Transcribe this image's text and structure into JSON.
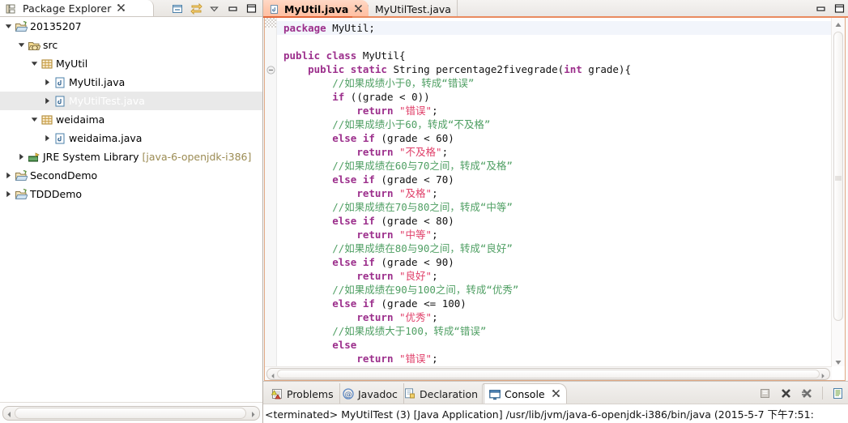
{
  "explorer": {
    "tab_label": "Package Explorer",
    "tab_close_icon": "close-icon",
    "toolbar": [
      {
        "name": "collapse-all-icon",
        "label": "Collapse All"
      },
      {
        "name": "link-with-editor-icon",
        "label": "Link with Editor"
      },
      {
        "name": "view-menu-icon",
        "label": "View Menu"
      },
      {
        "name": "minimize-icon",
        "label": "Minimize"
      },
      {
        "name": "maximize-icon",
        "label": "Maximize"
      }
    ],
    "tree": [
      {
        "label": "20135207",
        "indent": 0,
        "twisty": "expanded",
        "icon": "project-folder-icon",
        "selected": false
      },
      {
        "label": "src",
        "indent": 1,
        "twisty": "expanded",
        "icon": "source-folder-icon",
        "selected": false
      },
      {
        "label": "MyUtil",
        "indent": 2,
        "twisty": "expanded",
        "icon": "package-icon",
        "selected": false
      },
      {
        "label": "MyUtil.java",
        "indent": 3,
        "twisty": "collapsed",
        "icon": "java-file-icon",
        "selected": false
      },
      {
        "label": "MyUtilTest.java",
        "indent": 3,
        "twisty": "collapsed",
        "icon": "java-file-icon",
        "selected": true
      },
      {
        "label": "weidaima",
        "indent": 2,
        "twisty": "expanded",
        "icon": "package-icon",
        "selected": false
      },
      {
        "label": "weidaima.java",
        "indent": 3,
        "twisty": "collapsed",
        "icon": "java-file-icon",
        "selected": false
      },
      {
        "label": "JRE System Library",
        "suffix": "[java-6-openjdk-i386]",
        "indent": 1,
        "twisty": "collapsed",
        "icon": "jre-library-icon",
        "selected": false
      },
      {
        "label": "SecondDemo",
        "indent": 0,
        "twisty": "collapsed",
        "icon": "project-folder-icon",
        "selected": false
      },
      {
        "label": "TDDDemo",
        "indent": 0,
        "twisty": "collapsed",
        "icon": "project-folder-icon",
        "selected": false
      }
    ]
  },
  "editor": {
    "tabs": [
      {
        "label": "MyUtil.java",
        "icon": "java-file-icon",
        "active": true,
        "close_icon": "close-icon"
      },
      {
        "label": "MyUtilTest.java",
        "icon": "java-file-icon",
        "active": false
      }
    ],
    "window_buttons": [
      {
        "name": "minimize-icon",
        "label": "Minimize"
      },
      {
        "name": "maximize-icon",
        "label": "Maximize"
      }
    ],
    "fold_marker": "collapse-fold-icon",
    "code_lines": [
      [
        {
          "t": "kw",
          "s": "package"
        },
        {
          "t": "plain",
          "s": " MyUtil;"
        }
      ],
      [],
      [
        {
          "t": "kw",
          "s": "public class"
        },
        {
          "t": "plain",
          "s": " MyUtil{"
        }
      ],
      [
        {
          "t": "plain",
          "s": "    "
        },
        {
          "t": "kw",
          "s": "public static"
        },
        {
          "t": "plain",
          "s": " String percentage2fivegrade("
        },
        {
          "t": "kw",
          "s": "int"
        },
        {
          "t": "plain",
          "s": " grade){"
        }
      ],
      [
        {
          "t": "plain",
          "s": "        "
        },
        {
          "t": "cmt",
          "s": "//如果成绩小于0，转成“错误”"
        }
      ],
      [
        {
          "t": "plain",
          "s": "        "
        },
        {
          "t": "kw",
          "s": "if"
        },
        {
          "t": "plain",
          "s": " ((grade < 0))"
        }
      ],
      [
        {
          "t": "plain",
          "s": "            "
        },
        {
          "t": "kw",
          "s": "return"
        },
        {
          "t": "plain",
          "s": " "
        },
        {
          "t": "str",
          "s": "\"错误\""
        },
        {
          "t": "plain",
          "s": ";"
        }
      ],
      [
        {
          "t": "plain",
          "s": "        "
        },
        {
          "t": "cmt",
          "s": "//如果成绩小于60，转成“不及格”"
        }
      ],
      [
        {
          "t": "plain",
          "s": "        "
        },
        {
          "t": "kw",
          "s": "else if"
        },
        {
          "t": "plain",
          "s": " (grade < 60)"
        }
      ],
      [
        {
          "t": "plain",
          "s": "            "
        },
        {
          "t": "kw",
          "s": "return"
        },
        {
          "t": "plain",
          "s": " "
        },
        {
          "t": "str",
          "s": "\"不及格\""
        },
        {
          "t": "plain",
          "s": ";"
        }
      ],
      [
        {
          "t": "plain",
          "s": "        "
        },
        {
          "t": "cmt",
          "s": "//如果成绩在60与70之间，转成“及格”"
        }
      ],
      [
        {
          "t": "plain",
          "s": "        "
        },
        {
          "t": "kw",
          "s": "else if"
        },
        {
          "t": "plain",
          "s": " (grade < 70)"
        }
      ],
      [
        {
          "t": "plain",
          "s": "            "
        },
        {
          "t": "kw",
          "s": "return"
        },
        {
          "t": "plain",
          "s": " "
        },
        {
          "t": "str",
          "s": "\"及格\""
        },
        {
          "t": "plain",
          "s": ";"
        }
      ],
      [
        {
          "t": "plain",
          "s": "        "
        },
        {
          "t": "cmt",
          "s": "//如果成绩在70与80之间，转成“中等”"
        }
      ],
      [
        {
          "t": "plain",
          "s": "        "
        },
        {
          "t": "kw",
          "s": "else if"
        },
        {
          "t": "plain",
          "s": " (grade < 80)"
        }
      ],
      [
        {
          "t": "plain",
          "s": "            "
        },
        {
          "t": "kw",
          "s": "return"
        },
        {
          "t": "plain",
          "s": " "
        },
        {
          "t": "str",
          "s": "\"中等\""
        },
        {
          "t": "plain",
          "s": ";"
        }
      ],
      [
        {
          "t": "plain",
          "s": "        "
        },
        {
          "t": "cmt",
          "s": "//如果成绩在80与90之间，转成“良好”"
        }
      ],
      [
        {
          "t": "plain",
          "s": "        "
        },
        {
          "t": "kw",
          "s": "else if"
        },
        {
          "t": "plain",
          "s": " (grade < 90)"
        }
      ],
      [
        {
          "t": "plain",
          "s": "            "
        },
        {
          "t": "kw",
          "s": "return"
        },
        {
          "t": "plain",
          "s": " "
        },
        {
          "t": "str",
          "s": "\"良好\""
        },
        {
          "t": "plain",
          "s": ";"
        }
      ],
      [
        {
          "t": "plain",
          "s": "        "
        },
        {
          "t": "cmt",
          "s": "//如果成绩在90与100之间，转成“优秀”"
        }
      ],
      [
        {
          "t": "plain",
          "s": "        "
        },
        {
          "t": "kw",
          "s": "else if"
        },
        {
          "t": "plain",
          "s": " (grade <= 100)"
        }
      ],
      [
        {
          "t": "plain",
          "s": "            "
        },
        {
          "t": "kw",
          "s": "return"
        },
        {
          "t": "plain",
          "s": " "
        },
        {
          "t": "str",
          "s": "\"优秀\""
        },
        {
          "t": "plain",
          "s": ";"
        }
      ],
      [
        {
          "t": "plain",
          "s": "        "
        },
        {
          "t": "cmt",
          "s": "//如果成绩大于100，转成“错误”"
        }
      ],
      [
        {
          "t": "plain",
          "s": "        "
        },
        {
          "t": "kw",
          "s": "else"
        }
      ],
      [
        {
          "t": "plain",
          "s": "            "
        },
        {
          "t": "kw",
          "s": "return"
        },
        {
          "t": "plain",
          "s": " "
        },
        {
          "t": "str",
          "s": "\"错误\""
        },
        {
          "t": "plain",
          "s": ";"
        }
      ]
    ]
  },
  "console": {
    "tabs": [
      {
        "label": "Problems",
        "icon": "problems-icon",
        "active": false
      },
      {
        "label": "Javadoc",
        "icon": "javadoc-icon",
        "active": false
      },
      {
        "label": "Declaration",
        "icon": "declaration-icon",
        "active": false
      },
      {
        "label": "Console",
        "icon": "console-icon",
        "active": true,
        "close_icon": "close-icon"
      }
    ],
    "toolbar": [
      {
        "name": "clear-console-icon",
        "label": "Clear Console"
      },
      {
        "name": "terminate-icon",
        "label": "Terminate"
      },
      {
        "name": "remove-all-terminated-icon",
        "label": "Remove All Terminated Launches"
      },
      {
        "name": "display-selected-console-icon",
        "label": "Display Selected Console"
      }
    ],
    "status_line": "<terminated> MyUtilTest (3) [Java Application] /usr/lib/jvm/java-6-openjdk-i386/bin/java (2015-5-7 下午7:51:"
  },
  "colors": {
    "active_tab_gradient_start": "#ffd9c6",
    "active_tab_gradient_end": "#ffbfa2",
    "tab_underline": "#e2673a",
    "keyword": "#9c2f8c",
    "comment": "#4f9f63",
    "string": "#e0406a",
    "selection_bg": "#e9e9e9",
    "dim_text": "#9b8b53"
  }
}
